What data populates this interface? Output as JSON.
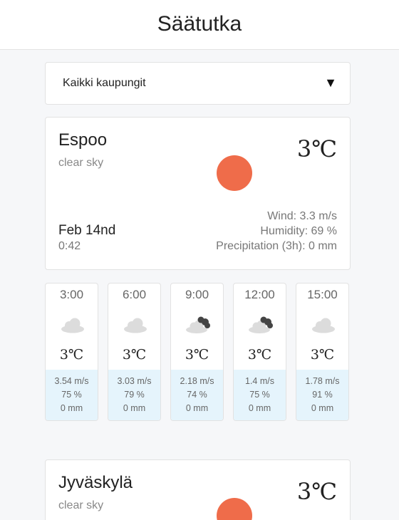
{
  "header": {
    "title": "Säätutka"
  },
  "select": {
    "value": "Kaikki kaupungit",
    "arrow": "▼"
  },
  "cities": [
    {
      "name": "Espoo",
      "desc": "clear sky",
      "temp": "3℃",
      "date": "Feb 14nd",
      "time": "0:42",
      "wind": "Wind: 3.3 m/s",
      "humidity": "Humidity: 69 %",
      "precip": "Precipitation (3h): 0 mm",
      "icon": "sun-icon"
    },
    {
      "name": "Jyväskylä",
      "desc": "clear sky",
      "temp": "3℃",
      "icon": "sun-icon"
    }
  ],
  "forecast": [
    {
      "hour": "3:00",
      "icon": "cloud-icon",
      "temp": "3℃",
      "wind": "3.54 m/s",
      "humidity": "75 %",
      "precip": "0 mm"
    },
    {
      "hour": "6:00",
      "icon": "cloud-icon",
      "temp": "3℃",
      "wind": "3.03 m/s",
      "humidity": "79 %",
      "precip": "0 mm"
    },
    {
      "hour": "9:00",
      "icon": "broken-clouds-icon",
      "temp": "3℃",
      "wind": "2.18 m/s",
      "humidity": "74 %",
      "precip": "0 mm"
    },
    {
      "hour": "12:00",
      "icon": "broken-clouds-icon",
      "temp": "3℃",
      "wind": "1.4 m/s",
      "humidity": "75 %",
      "precip": "0 mm"
    },
    {
      "hour": "15:00",
      "icon": "cloud-icon",
      "temp": "3℃",
      "wind": "1.78 m/s",
      "humidity": "91 %",
      "precip": "0 mm"
    }
  ],
  "colors": {
    "sun": "#ef6c4a",
    "forecast_bg": "#e5f4fc"
  }
}
